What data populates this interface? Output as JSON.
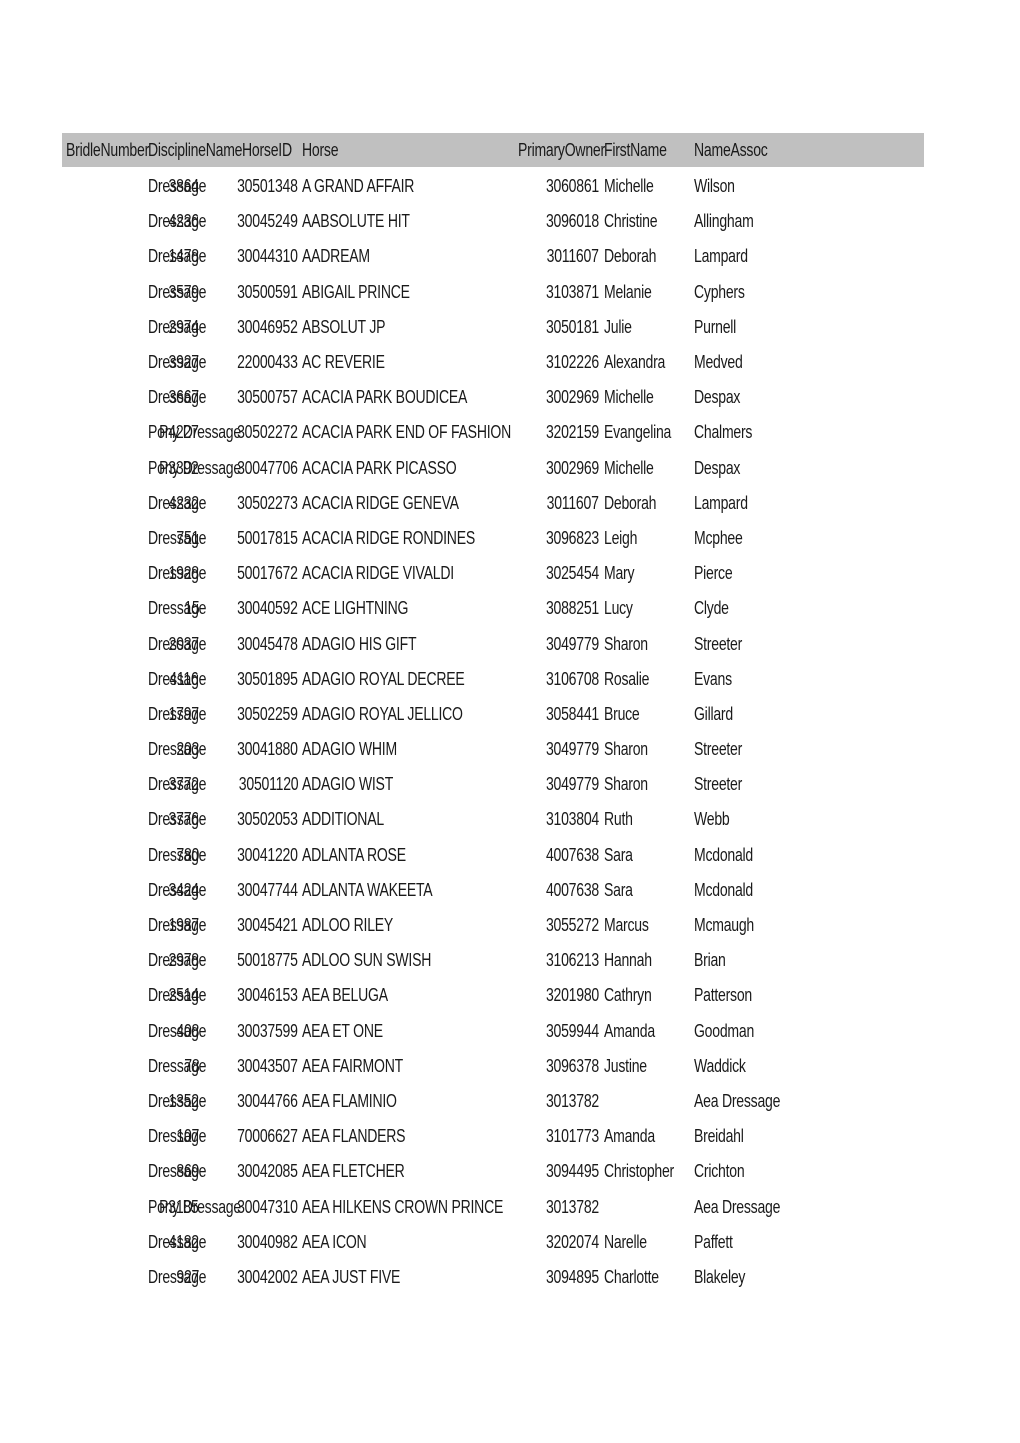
{
  "table": {
    "columns": [
      "BridleNumber",
      "DisciplineName",
      "HorseID",
      "Horse",
      "PrimaryOwner",
      "FirstName",
      "NameAssoc"
    ],
    "header_color": "#c0c0c0",
    "rows": [
      [
        "3864",
        "Dressage",
        "30501348",
        "A GRAND AFFAIR",
        "3060861",
        "Michelle",
        "Wilson"
      ],
      [
        "4236",
        "Dressage",
        "30045249",
        "AABSOLUTE HIT",
        "3096018",
        "Christine",
        "Allingham"
      ],
      [
        "1478",
        "Dressage",
        "30044310",
        "AADREAM",
        "3011607",
        "Deborah",
        "Lampard"
      ],
      [
        "3579",
        "Dressage",
        "30500591",
        "ABIGAIL PRINCE",
        "3103871",
        "Melanie",
        "Cyphers"
      ],
      [
        "2974",
        "Dressage",
        "30046952",
        "ABSOLUT JP",
        "3050181",
        "Julie",
        "Purnell"
      ],
      [
        "3927",
        "Dressage",
        "22000433",
        "AC REVERIE",
        "3102226",
        "Alexandra",
        "Medved"
      ],
      [
        "3667",
        "Dressage",
        "30500757",
        "ACACIA PARK BOUDICEA",
        "3002969",
        "Michelle",
        "Despax"
      ],
      [
        "P4227",
        "Pony Dressage",
        "30502272",
        "ACACIA PARK END OF FASHION",
        "3202159",
        "Evangelina",
        "Chalmers"
      ],
      [
        "P3392",
        "Pony Dressage",
        "30047706",
        "ACACIA PARK PICASSO",
        "3002969",
        "Michelle",
        "Despax"
      ],
      [
        "4232",
        "Dressage",
        "30502273",
        "ACACIA RIDGE GENEVA",
        "3011607",
        "Deborah",
        "Lampard"
      ],
      [
        "751",
        "Dressage",
        "50017815",
        "ACACIA RIDGE RONDINES",
        "3096823",
        "Leigh",
        "Mcphee"
      ],
      [
        "1928",
        "Dressage",
        "50017672",
        "ACACIA RIDGE VIVALDI",
        "3025454",
        "Mary",
        "Pierce"
      ],
      [
        "15",
        "Dressage",
        "30040592",
        "ACE LIGHTNING",
        "3088251",
        "Lucy",
        "Clyde"
      ],
      [
        "2037",
        "Dressage",
        "30045478",
        "ADAGIO HIS GIFT",
        "3049779",
        "Sharon",
        "Streeter"
      ],
      [
        "4116",
        "Dressage",
        "30501895",
        "ADAGIO ROYAL DECREE",
        "3106708",
        "Rosalie",
        "Evans"
      ],
      [
        "1797",
        "Dressage",
        "30502259",
        "ADAGIO ROYAL JELLICO",
        "3058441",
        "Bruce",
        "Gillard"
      ],
      [
        "203",
        "Dressage",
        "30041880",
        "ADAGIO WHIM",
        "3049779",
        "Sharon",
        "Streeter"
      ],
      [
        "3772",
        "Dressage",
        "30501120",
        "ADAGIO WIST",
        "3049779",
        "Sharon",
        "Streeter"
      ],
      [
        "3776",
        "Dressage",
        "30502053",
        "ADDITIONAL",
        "3103804",
        "Ruth",
        "Webb"
      ],
      [
        "780",
        "Dressage",
        "30041220",
        "ADLANTA ROSE",
        "4007638",
        "Sara",
        "Mcdonald"
      ],
      [
        "3424",
        "Dressage",
        "30047744",
        "ADLANTA WAKEETA",
        "4007638",
        "Sara",
        "Mcdonald"
      ],
      [
        "1987",
        "Dressage",
        "30045421",
        "ADLOO RILEY",
        "3055272",
        "Marcus",
        "Mcmaugh"
      ],
      [
        "2978",
        "Dressage",
        "50018775",
        "ADLOO SUN SWISH",
        "3106213",
        "Hannah",
        "Brian"
      ],
      [
        "2514",
        "Dressage",
        "30046153",
        "AEA BELUGA",
        "3201980",
        "Cathryn",
        "Patterson"
      ],
      [
        "408",
        "Dressage",
        "30037599",
        "AEA ET ONE",
        "3059944",
        "Amanda",
        "Goodman"
      ],
      [
        "78",
        "Dressage",
        "30043507",
        "AEA FAIRMONT",
        "3096378",
        "Justine",
        "Waddick"
      ],
      [
        "1352",
        "Dressage",
        "30044766",
        "AEA FLAMINIO",
        "3013782",
        "",
        "Aea Dressage"
      ],
      [
        "107",
        "Dressage",
        "70006627",
        "AEA FLANDERS",
        "3101773",
        "Amanda",
        "Breidahl"
      ],
      [
        "869",
        "Dressage",
        "30042085",
        "AEA FLETCHER",
        "3094495",
        "Christopher",
        "Crichton"
      ],
      [
        "P3185",
        "Pony Dressage",
        "30047310",
        "AEA HILKENS CROWN PRINCE",
        "3013782",
        "",
        "Aea Dressage"
      ],
      [
        "4182",
        "Dressage",
        "30040982",
        "AEA ICON",
        "3202074",
        "Narelle",
        "Paffett"
      ],
      [
        "927",
        "Dressage",
        "30042002",
        "AEA JUST FIVE",
        "3094895",
        "Charlotte",
        "Blakeley"
      ]
    ]
  }
}
